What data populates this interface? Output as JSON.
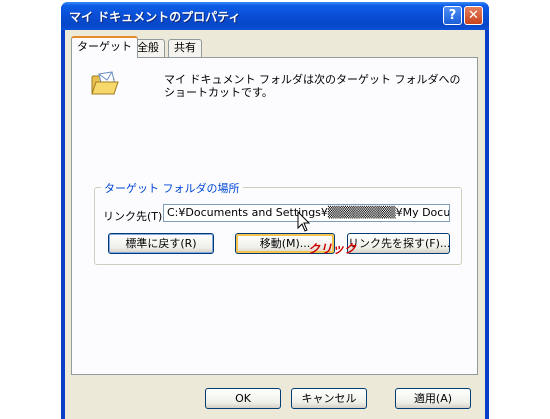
{
  "window": {
    "title": "マイ ドキュメントのプロパティ",
    "help_label": "?",
    "close_label": "✕"
  },
  "tabs": [
    {
      "label": "ターゲット"
    },
    {
      "label": "全般"
    },
    {
      "label": "共有"
    }
  ],
  "panel": {
    "description": "マイ ドキュメント フォルダは次のターゲット フォルダへのショートカットです。",
    "group_label": "ターゲット フォルダの場所",
    "link_label": "リンク先(T):",
    "link_value": "C:¥Documents and Settings¥▒▒▒▒▒▒▒▒¥My Documents",
    "restore_button": "標準に戻す(R)",
    "move_button": "移動(M)...",
    "find_target_button": "リンク先を探す(F)..."
  },
  "annotation": {
    "click_label": "クリック"
  },
  "footer": {
    "ok_label": "OK",
    "cancel_label": "キャンセル",
    "apply_label": "適用(A)"
  },
  "colors": {
    "titlebar": "#0a4fd7",
    "accent_tab": "#e68b2c",
    "annotation": "#cc0000"
  },
  "icons": {
    "folder": "open-folder-with-letter-icon",
    "cursor": "mouse-pointer-icon"
  }
}
